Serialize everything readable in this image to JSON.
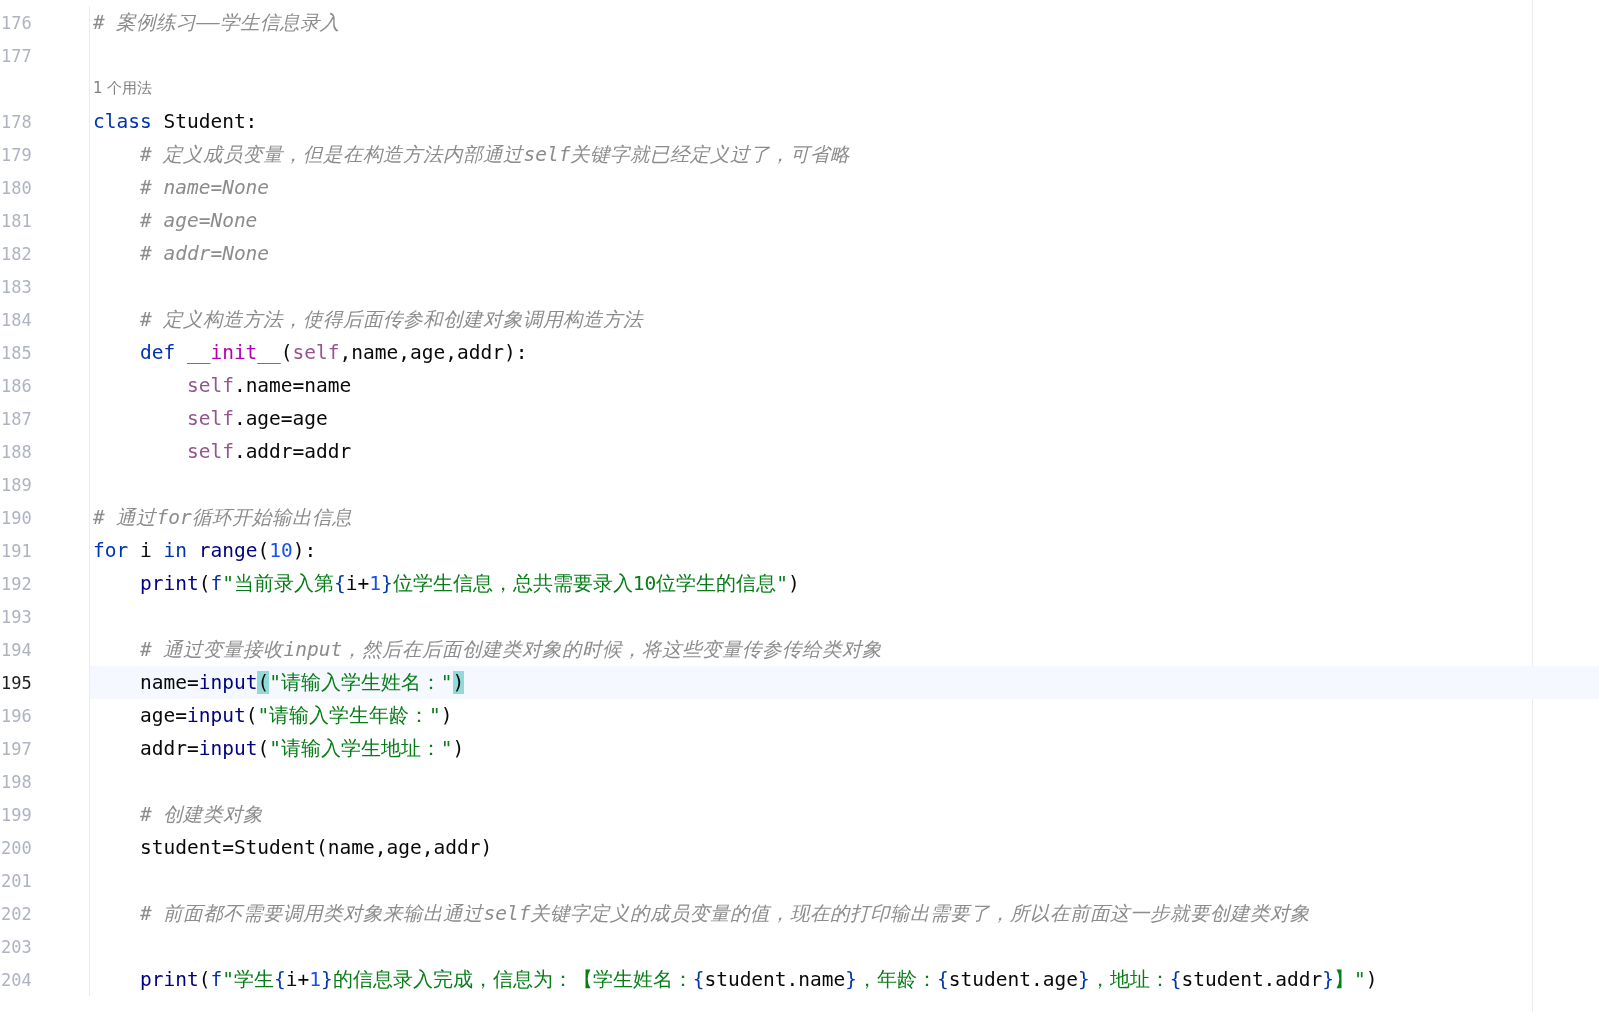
{
  "lines": [
    {
      "number": "176",
      "current": false,
      "tokens": [
        {
          "kind": "comment",
          "text": "# 案例练习——学生信息录入"
        }
      ]
    },
    {
      "number": "177",
      "current": false
    },
    {
      "current": false,
      "hint": "1 个用法"
    },
    {
      "number": "178",
      "current": false,
      "tokens": [
        {
          "kind": "kw",
          "text": "class"
        },
        {
          "kind": "plain",
          "text": " Student:"
        }
      ]
    },
    {
      "number": "179",
      "current": false,
      "tokens": [
        {
          "kind": "comment",
          "text": "    # 定义成员变量，但是在构造方法内部通过self关键字就已经定义过了，可省略"
        }
      ]
    },
    {
      "number": "180",
      "current": false,
      "tokens": [
        {
          "kind": "comment",
          "text": "    # name=None"
        }
      ]
    },
    {
      "number": "181",
      "current": false,
      "tokens": [
        {
          "kind": "comment",
          "text": "    # age=None"
        }
      ]
    },
    {
      "number": "182",
      "current": false,
      "tokens": [
        {
          "kind": "comment",
          "text": "    # addr=None"
        }
      ]
    },
    {
      "number": "183",
      "current": false
    },
    {
      "number": "184",
      "current": false,
      "tokens": [
        {
          "kind": "comment",
          "text": "    # 定义构造方法，使得后面传参和创建对象调用构造方法"
        }
      ]
    },
    {
      "number": "185",
      "current": false,
      "tokens": [
        {
          "kind": "kw",
          "text": "    def "
        },
        {
          "kind": "dunder",
          "text": "__init__"
        },
        {
          "kind": "plain",
          "text": "("
        },
        {
          "kind": "self",
          "text": "self"
        },
        {
          "kind": "plain",
          "text": ",name,age,addr):"
        }
      ]
    },
    {
      "number": "186",
      "current": false,
      "tokens": [
        {
          "kind": "self",
          "text": "        self"
        },
        {
          "kind": "plain",
          "text": ".name=name"
        }
      ]
    },
    {
      "number": "187",
      "current": false,
      "tokens": [
        {
          "kind": "self",
          "text": "        self"
        },
        {
          "kind": "plain",
          "text": ".age=age"
        }
      ]
    },
    {
      "number": "188",
      "current": false,
      "tokens": [
        {
          "kind": "self",
          "text": "        self"
        },
        {
          "kind": "plain",
          "text": ".addr=addr"
        }
      ]
    },
    {
      "number": "189",
      "current": false
    },
    {
      "number": "190",
      "current": false,
      "tokens": [
        {
          "kind": "comment",
          "text": "# 通过for循环开始输出信息"
        }
      ]
    },
    {
      "number": "191",
      "current": false,
      "tokens": [
        {
          "kind": "kw",
          "text": "for"
        },
        {
          "kind": "plain",
          "text": " i "
        },
        {
          "kind": "kw",
          "text": "in "
        },
        {
          "kind": "builtin",
          "text": "range"
        },
        {
          "kind": "plain",
          "text": "("
        },
        {
          "kind": "num",
          "text": "10"
        },
        {
          "kind": "plain",
          "text": "):"
        }
      ]
    },
    {
      "number": "192",
      "current": false,
      "tokens": [
        {
          "kind": "builtin",
          "text": "    print"
        },
        {
          "kind": "plain",
          "text": "("
        },
        {
          "kind": "kw",
          "text": "f"
        },
        {
          "kind": "str",
          "text": "\"当前录入第"
        },
        {
          "kind": "brace",
          "text": "{"
        },
        {
          "kind": "plain",
          "text": "i+"
        },
        {
          "kind": "num",
          "text": "1"
        },
        {
          "kind": "brace",
          "text": "}"
        },
        {
          "kind": "str",
          "text": "位学生信息，总共需要录入10位学生的信息\""
        },
        {
          "kind": "plain",
          "text": ")"
        }
      ]
    },
    {
      "number": "193",
      "current": false
    },
    {
      "number": "194",
      "current": false,
      "tokens": [
        {
          "kind": "comment",
          "text": "    # 通过变量接收input，然后在后面创建类对象的时候，将这些变量传参传给类对象"
        }
      ]
    },
    {
      "number": "195",
      "current": true,
      "tokens": [
        {
          "kind": "plain",
          "text": "    name="
        },
        {
          "kind": "builtin",
          "text": "input"
        },
        {
          "kind": "match",
          "text": "("
        },
        {
          "kind": "str",
          "text": "\"请输入学生姓名：\""
        },
        {
          "kind": "match",
          "text": ")"
        }
      ]
    },
    {
      "number": "196",
      "current": false,
      "tokens": [
        {
          "kind": "plain",
          "text": "    age="
        },
        {
          "kind": "builtin",
          "text": "input"
        },
        {
          "kind": "plain",
          "text": "("
        },
        {
          "kind": "str",
          "text": "\"请输入学生年龄：\""
        },
        {
          "kind": "plain",
          "text": ")"
        }
      ]
    },
    {
      "number": "197",
      "current": false,
      "tokens": [
        {
          "kind": "plain",
          "text": "    addr="
        },
        {
          "kind": "builtin",
          "text": "input"
        },
        {
          "kind": "plain",
          "text": "("
        },
        {
          "kind": "str",
          "text": "\"请输入学生地址：\""
        },
        {
          "kind": "plain",
          "text": ")"
        }
      ]
    },
    {
      "number": "198",
      "current": false
    },
    {
      "number": "199",
      "current": false,
      "tokens": [
        {
          "kind": "comment",
          "text": "    # 创建类对象"
        }
      ]
    },
    {
      "number": "200",
      "current": false,
      "tokens": [
        {
          "kind": "plain",
          "text": "    student=Student(name,age,addr)"
        }
      ]
    },
    {
      "number": "201",
      "current": false
    },
    {
      "number": "202",
      "current": false,
      "tokens": [
        {
          "kind": "comment",
          "text": "    # 前面都不需要调用类对象来输出通过self关键字定义的成员变量的值，现在的打印输出需要了，所以在前面这一步就要创建类对象"
        }
      ]
    },
    {
      "number": "203",
      "current": false
    },
    {
      "number": "204",
      "current": false,
      "tokens": [
        {
          "kind": "builtin",
          "text": "    print"
        },
        {
          "kind": "plain",
          "text": "("
        },
        {
          "kind": "kw",
          "text": "f"
        },
        {
          "kind": "str",
          "text": "\"学生"
        },
        {
          "kind": "brace",
          "text": "{"
        },
        {
          "kind": "plain",
          "text": "i+"
        },
        {
          "kind": "num",
          "text": "1"
        },
        {
          "kind": "brace",
          "text": "}"
        },
        {
          "kind": "str",
          "text": "的信息录入完成，信息为：【学生姓名："
        },
        {
          "kind": "brace",
          "text": "{"
        },
        {
          "kind": "plain",
          "text": "student.name"
        },
        {
          "kind": "brace",
          "text": "}"
        },
        {
          "kind": "str",
          "text": "，年龄："
        },
        {
          "kind": "brace",
          "text": "{"
        },
        {
          "kind": "plain",
          "text": "student.age"
        },
        {
          "kind": "brace",
          "text": "}"
        },
        {
          "kind": "str",
          "text": "，地址："
        },
        {
          "kind": "brace",
          "text": "{"
        },
        {
          "kind": "plain",
          "text": "student.addr"
        },
        {
          "kind": "brace",
          "text": "}"
        },
        {
          "kind": "str",
          "text": "】\""
        },
        {
          "kind": "plain",
          "text": ")"
        }
      ]
    }
  ]
}
